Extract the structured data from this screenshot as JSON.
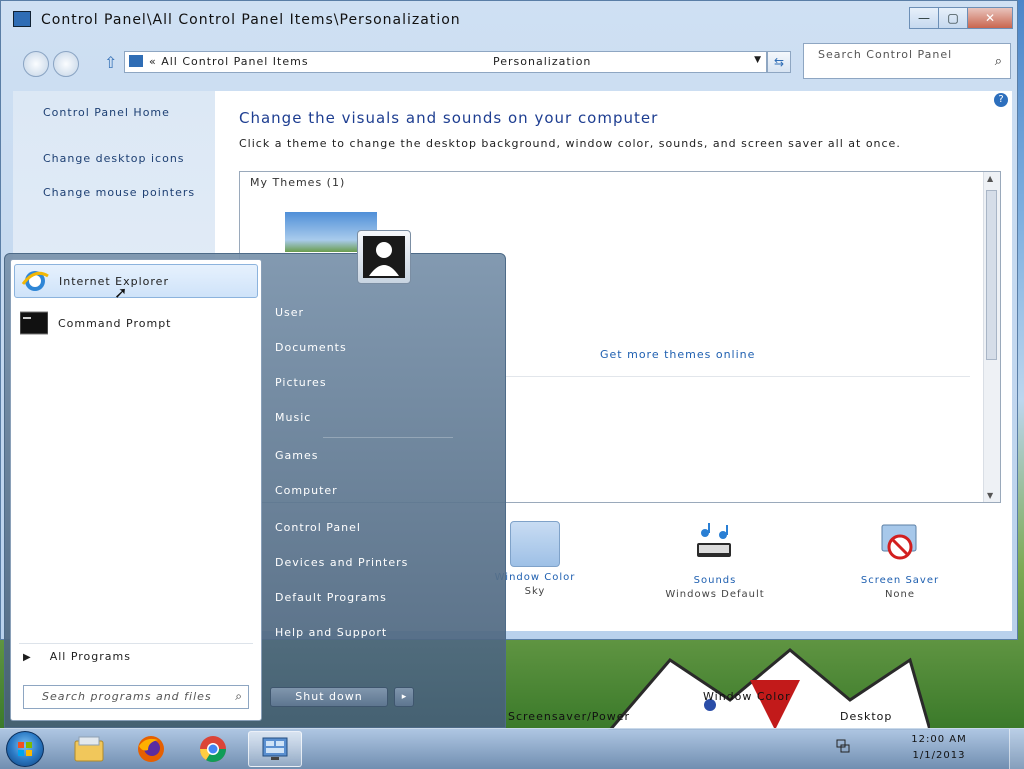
{
  "window": {
    "title": "Control Panel\\All Control Panel Items\\Personalization",
    "controls": {
      "minimize": "—",
      "maximize": "▢",
      "close": "✕"
    }
  },
  "nav": {
    "address_prefix": "« All Control Panel Items",
    "address_current": "Personalization",
    "search_placeholder": "Search Control Panel"
  },
  "left_pane": {
    "links": [
      "Control Panel Home",
      "Change desktop icons",
      "Change mouse pointers"
    ]
  },
  "main": {
    "heading": "Change the visuals and sounds on your computer",
    "description": "Click a theme to change the desktop background, window color, sounds, and screen saver all at once.",
    "themes_header": "My Themes (1)",
    "online_link": "Get more themes online",
    "bottom_items": [
      {
        "label": "Window Color",
        "sub": "Sky"
      },
      {
        "label": "Sounds",
        "sub": "Windows Default"
      },
      {
        "label": "Screen Saver",
        "sub": "None"
      }
    ]
  },
  "start_menu": {
    "programs": [
      "Internet Explorer",
      "Command Prompt"
    ],
    "all_programs": "All Programs",
    "search_placeholder": "Search programs and files",
    "right_items": [
      "User",
      "Documents",
      "Pictures",
      "Music",
      "Games",
      "Computer",
      "Control Panel",
      "Devices and Printers",
      "Default Programs",
      "Help and Support"
    ],
    "shutdown": "Shut down",
    "shutdown_arrow": "▸"
  },
  "taskbar": {
    "pinned": [
      "Start",
      "Windows Explorer",
      "Firefox",
      "Chrome",
      "Control Panel"
    ],
    "clock_time": "12:00 AM",
    "clock_date": "1/1/2013"
  },
  "desktop": {
    "overlay_text_1": "Screensaver/Power",
    "overlay_text_2": "Window Color",
    "overlay_text_3": "Desktop"
  }
}
